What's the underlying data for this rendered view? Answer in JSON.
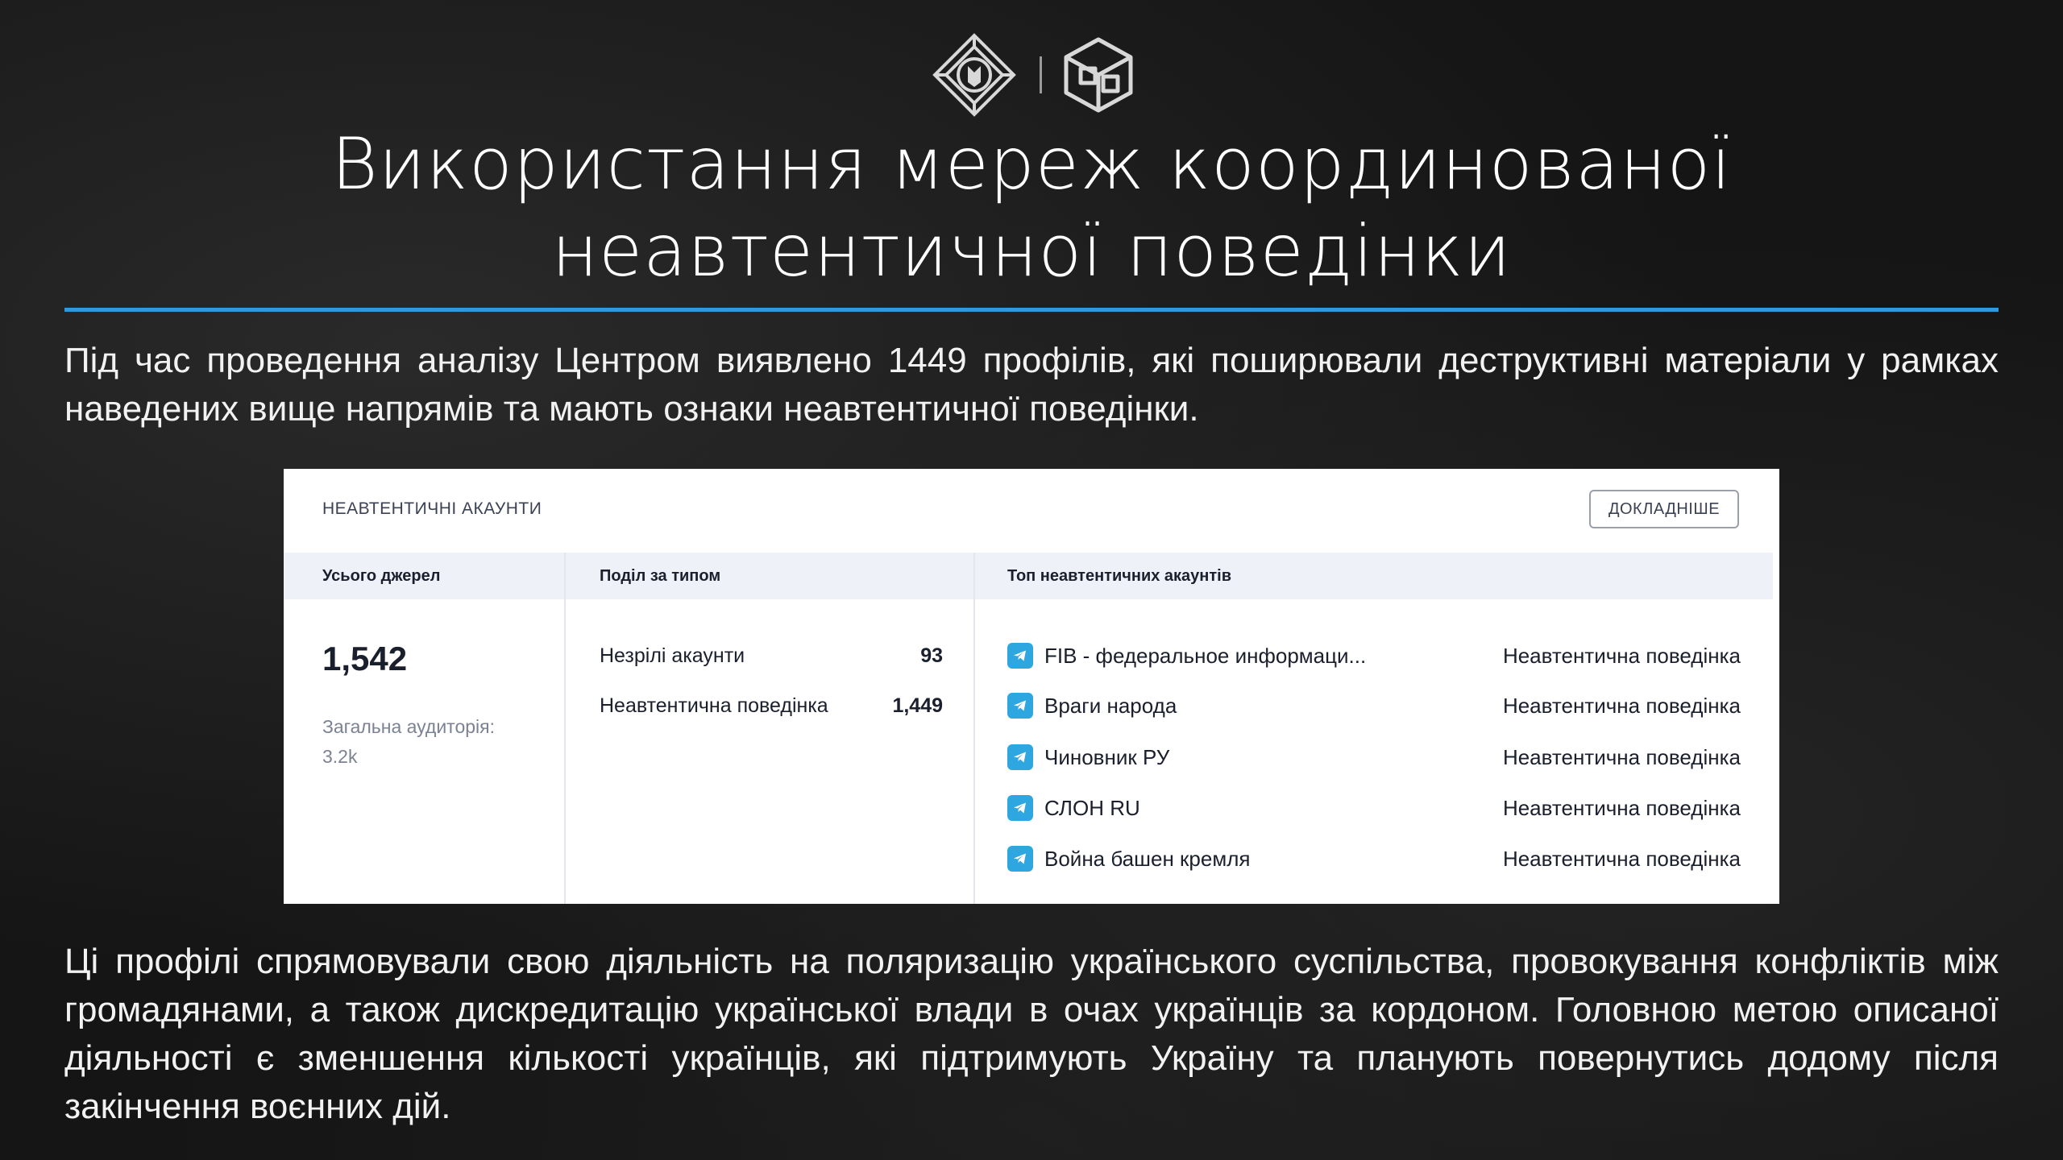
{
  "slide": {
    "title_line1": "Використання мереж координованої",
    "title_line2": "неавтентичної поведінки",
    "paragraph1": "Під час проведення аналізу Центром виявлено 1449 профілів, які поширювали деструктивні матеріали у рамках наведених вище напрямів та мають ознаки неавтентичної поведінки.",
    "paragraph2": "Ці профілі спрямовували свою діяльність на поляризацію українського суспільства, провокування конфліктів між громадянами, а також дискредитацію української влади в очах українців за кордоном. Головною метою описаної діяльності є зменшення кількості українців, які підтримують Україну та планують повернутись додому після закінчення воєнних дій."
  },
  "panel": {
    "title": "НЕАВТЕНТИЧНІ АКАУНТИ",
    "details_button": "ДОКЛАДНІШЕ",
    "col1_header": "Усього джерел",
    "col2_header": "Поділ за типом",
    "col3_header": "Топ неавтентичних акаунтів",
    "total_sources": "1,542",
    "audience_label": "Загальна аудиторія:",
    "audience_value": "3.2k",
    "types": [
      {
        "label": "Незрілі акаунти",
        "value": "93"
      },
      {
        "label": "Неавтентична поведінка",
        "value": "1,449"
      }
    ],
    "accounts": [
      {
        "name": "FIB - федеральное информаци...",
        "type": "Неавтентична поведінка"
      },
      {
        "name": "Враги народа",
        "type": "Неавтентична поведінка"
      },
      {
        "name": "Чиновник РУ",
        "type": "Неавтентична поведінка"
      },
      {
        "name": "СЛОН RU",
        "type": "Неавтентична поведінка"
      },
      {
        "name": "Война башен кремля",
        "type": "Неавтентична поведінка"
      }
    ]
  },
  "icons": {
    "logo_left": "emblem-logo-icon",
    "logo_right": "cube-logo-icon",
    "account_icon": "telegram-icon"
  },
  "colors": {
    "accent_rule": "#2e9ad6",
    "telegram": "#2ea6df"
  }
}
